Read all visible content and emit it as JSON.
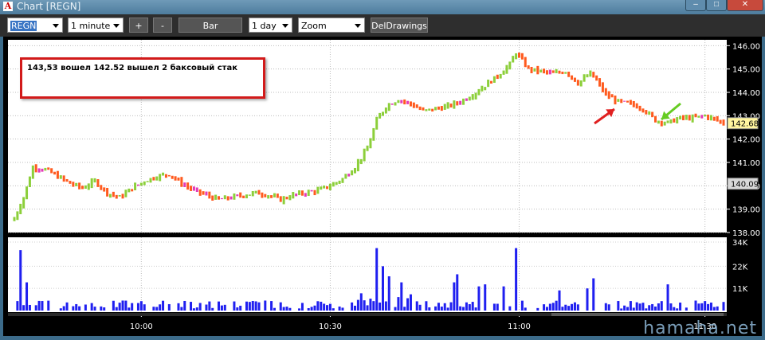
{
  "window": {
    "title": "Chart [REGN]",
    "icon_glyph": "A",
    "minimize_glyph": "–",
    "maximize_glyph": "□",
    "close_glyph": "✕"
  },
  "toolbar": {
    "symbol": "REGN",
    "interval": "1 minute",
    "plus_label": "+",
    "minus_label": "-",
    "chart_type_label": "Bar",
    "period": "1 day",
    "zoom": "Zoom",
    "del_drawings_label": "DelDrawings"
  },
  "annotation": {
    "text": "143,53 вошел 142.52 вышел 2 баксовый стак"
  },
  "watermark": "hamaha.net",
  "colors": {
    "up": "#8ccf3a",
    "down": "#ff5a1e",
    "neutral": "#e33ab8",
    "volume": "#1f1ff0",
    "note_border": "#d21a1a",
    "red_arrow": "#e02020",
    "green_arrow": "#66cc22"
  },
  "chart_data": [
    {
      "type": "bar",
      "title": "",
      "price_axis_labels": [
        "146.00",
        "145.00",
        "144.00",
        "143.00",
        "142.00",
        "141.00",
        "140.00",
        "139.00",
        "138.00"
      ],
      "ylim": [
        138,
        146.25
      ],
      "time_axis_labels": [
        "10:00",
        "10:30",
        "11:00",
        "11:30"
      ],
      "last_price_label": "142.68",
      "secondary_price_label": "140.09",
      "close_anchors": [
        [
          0,
          138.6
        ],
        [
          3,
          139.5
        ],
        [
          6,
          140.8
        ],
        [
          10,
          140.7
        ],
        [
          14,
          140.4
        ],
        [
          18,
          140.1
        ],
        [
          22,
          139.9
        ],
        [
          26,
          140.2
        ],
        [
          30,
          139.7
        ],
        [
          34,
          139.5
        ],
        [
          38,
          139.9
        ],
        [
          42,
          140.2
        ],
        [
          46,
          140.4
        ],
        [
          50,
          140.5
        ],
        [
          54,
          140.1
        ],
        [
          58,
          139.8
        ],
        [
          62,
          139.6
        ],
        [
          66,
          139.4
        ],
        [
          70,
          139.5
        ],
        [
          74,
          139.6
        ],
        [
          78,
          139.7
        ],
        [
          82,
          139.6
        ],
        [
          86,
          139.4
        ],
        [
          90,
          139.6
        ],
        [
          94,
          139.7
        ],
        [
          98,
          139.8
        ],
        [
          102,
          140.0
        ],
        [
          106,
          140.3
        ],
        [
          110,
          140.8
        ],
        [
          114,
          141.6
        ],
        [
          117,
          142.8
        ],
        [
          120,
          143.4
        ],
        [
          124,
          143.7
        ],
        [
          128,
          143.5
        ],
        [
          132,
          143.2
        ],
        [
          136,
          143.3
        ],
        [
          140,
          143.4
        ],
        [
          144,
          143.6
        ],
        [
          148,
          143.9
        ],
        [
          152,
          144.3
        ],
        [
          156,
          144.7
        ],
        [
          160,
          145.2
        ],
        [
          162,
          145.7
        ],
        [
          166,
          145.0
        ],
        [
          170,
          144.9
        ],
        [
          174,
          144.8
        ],
        [
          178,
          144.9
        ],
        [
          182,
          144.4
        ],
        [
          186,
          144.8
        ],
        [
          188,
          144.5
        ],
        [
          191,
          143.9
        ],
        [
          195,
          143.6
        ],
        [
          199,
          143.5
        ],
        [
          203,
          143.3
        ],
        [
          207,
          142.8
        ],
        [
          211,
          142.7
        ],
        [
          215,
          142.9
        ],
        [
          219,
          142.9
        ],
        [
          223,
          143.0
        ],
        [
          227,
          142.8
        ],
        [
          229,
          142.68
        ]
      ]
    },
    {
      "type": "bar",
      "title": "",
      "volume_axis_labels": [
        "34K",
        "22K",
        "11K"
      ],
      "ylim": [
        0,
        34
      ],
      "spikes_k": [
        [
          2,
          30
        ],
        [
          4,
          14
        ],
        [
          117,
          31
        ],
        [
          121,
          17
        ],
        [
          143,
          18
        ],
        [
          162,
          31
        ],
        [
          152,
          13
        ],
        [
          158,
          12
        ],
        [
          176,
          10
        ],
        [
          187,
          16
        ],
        [
          211,
          13
        ],
        [
          185,
          11
        ],
        [
          142,
          14
        ],
        [
          150,
          12
        ],
        [
          119,
          22
        ],
        [
          125,
          14
        ]
      ]
    }
  ]
}
